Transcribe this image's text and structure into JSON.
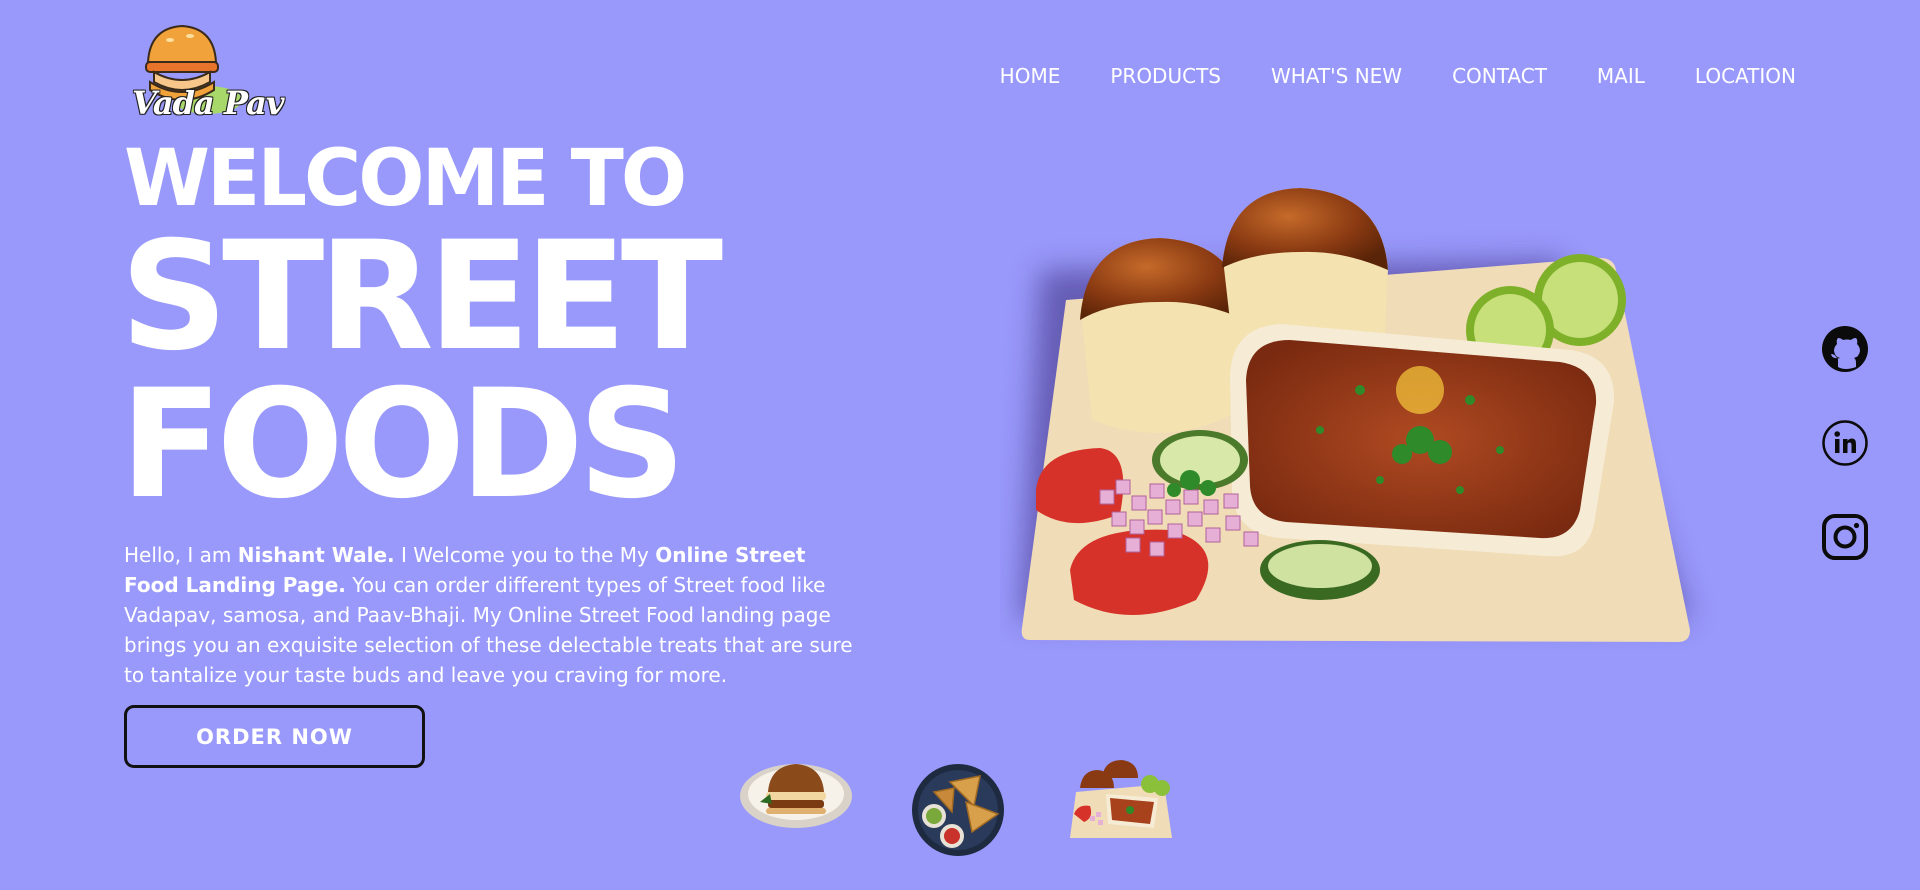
{
  "logo": {
    "text": "Vada Pav"
  },
  "nav": {
    "items": [
      {
        "label": "HOME"
      },
      {
        "label": "PRODUCTS"
      },
      {
        "label": "WHAT'S NEW"
      },
      {
        "label": "CONTACT"
      },
      {
        "label": "MAIL"
      },
      {
        "label": "LOCATION"
      }
    ]
  },
  "hero": {
    "line1": "WELCOME TO",
    "line2": "STREET",
    "line3": "FOODS"
  },
  "intro": {
    "part1": "Hello, I am ",
    "name": "Nishant Wale.",
    "part2": " I Welcome you to the My ",
    "page_name": "Online Street Food Landing Page.",
    "part3": " You can order different types of Street food like Vadapav, samosa, and Paav-Bhaji. My Online Street Food landing page brings you an exquisite selection of these delectable treats that are sure to tantalize your taste buds and leave you craving for more."
  },
  "order_button": {
    "label": "ORDER NOW"
  },
  "thumbnails": [
    {
      "icon": "vada-pav-thumbnail"
    },
    {
      "icon": "samosa-thumbnail"
    },
    {
      "icon": "pav-bhaji-thumbnail"
    }
  ],
  "social": [
    {
      "icon": "github-icon"
    },
    {
      "icon": "linkedin-icon"
    },
    {
      "icon": "instagram-icon"
    }
  ],
  "colors": {
    "background": "#9999fb",
    "text": "#ffffff",
    "icon": "#111111"
  }
}
